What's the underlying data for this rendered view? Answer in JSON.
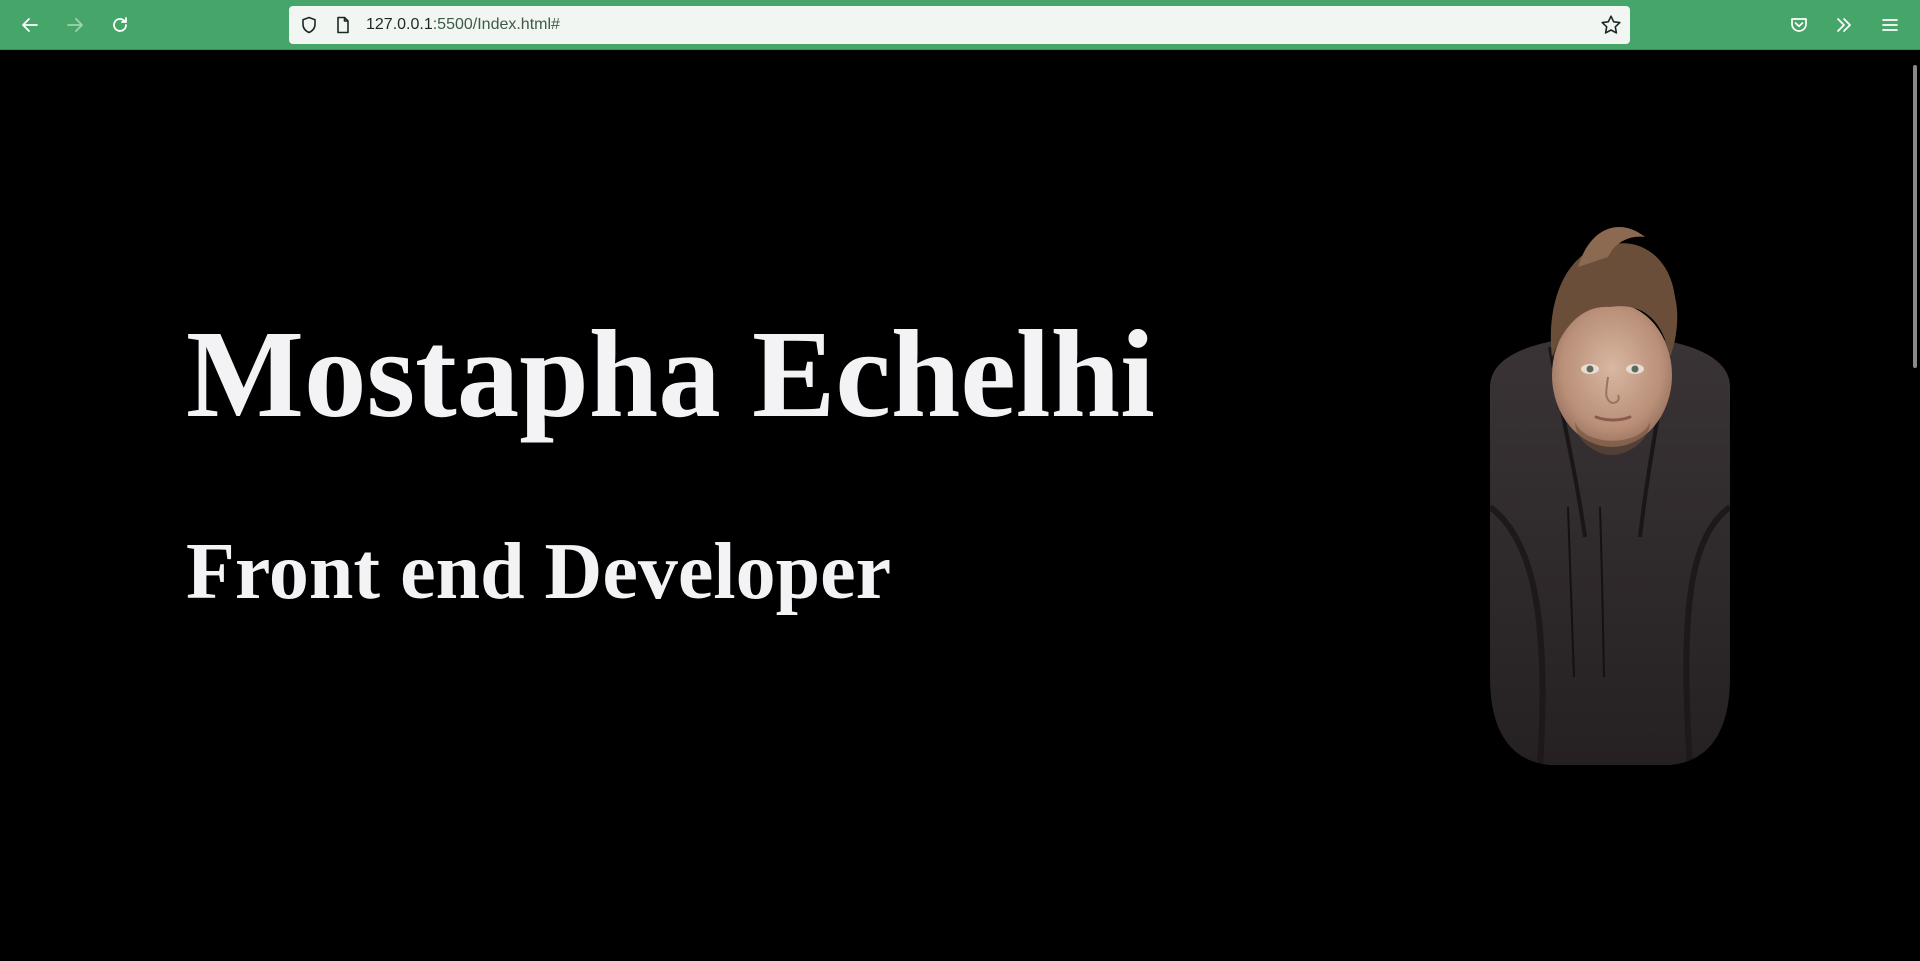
{
  "browser": {
    "url_host": "127.0.0.1",
    "url_path": ":5500/Index.html#",
    "icons": {
      "back": "arrow-left-icon",
      "forward": "arrow-right-icon",
      "reload": "reload-icon",
      "shield": "shield-icon",
      "page": "page-icon",
      "bookmark": "star-icon",
      "pocket": "pocket-icon",
      "overflow": "chevrons-right-icon",
      "menu": "hamburger-menu-icon"
    },
    "toolbar_color": "#46a66a"
  },
  "hero": {
    "name": "Mostapha Echelhi",
    "role": "Front end Developer",
    "text_color": "#f3f3f6",
    "background": "#000000"
  }
}
